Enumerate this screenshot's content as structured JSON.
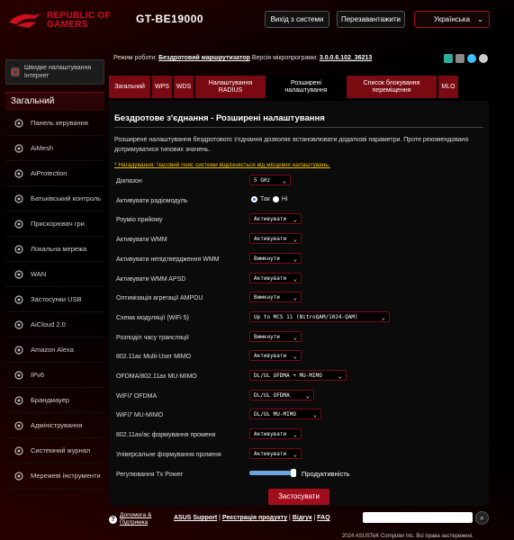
{
  "header": {
    "brand_line1": "REPUBLIC OF",
    "brand_line2": "GAMERS",
    "model": "GT-BE19000",
    "logout_label": "Вихід з системи",
    "reboot_label": "Перезавантажити",
    "language": "Українська"
  },
  "info": {
    "mode_label": "Режим роботи:",
    "mode_value": "Бездротовий маршрутизатор",
    "fw_label": "Версія мікропрограми:",
    "fw_value": "3.0.0.6.102_36213"
  },
  "sidebar": {
    "quick": "Швидке налаштування Інтернет",
    "section": "Загальний",
    "items": [
      {
        "label": "Панель керування",
        "icon": "dashboard-icon"
      },
      {
        "label": "AiMesh",
        "icon": "aimesh-icon"
      },
      {
        "label": "AiProtection",
        "icon": "shield-icon"
      },
      {
        "label": "Батьківський контроль",
        "icon": "parental-icon"
      },
      {
        "label": "Прискорювач гри",
        "icon": "gamepad-icon"
      },
      {
        "label": "Локальна мережа",
        "icon": "lan-icon"
      },
      {
        "label": "WAN",
        "icon": "globe-icon"
      },
      {
        "label": "Застосунки USB",
        "icon": "usb-icon"
      },
      {
        "label": "AiCloud 2.0",
        "icon": "cloud-icon"
      },
      {
        "label": "Amazon Alexa",
        "icon": "alexa-icon"
      },
      {
        "label": "IPv6",
        "icon": "ipv6-icon"
      },
      {
        "label": "Брандмауер",
        "icon": "firewall-icon"
      },
      {
        "label": "Адміністрування",
        "icon": "admin-icon"
      },
      {
        "label": "Системний журнал",
        "icon": "log-icon"
      },
      {
        "label": "Мережеві інструменти",
        "icon": "tools-icon"
      }
    ]
  },
  "tabs": [
    "Загальний",
    "WPS",
    "WDS",
    "Налаштування RADIUS",
    "Розширені налаштування",
    "Список блокування переміщення",
    "MLO"
  ],
  "panel": {
    "title": "Бездротове з'єднання - Розширені налаштування",
    "description": "Розширене налаштування бездротового з'єднання дозволяє встановлювати додаткові параметри. Проте рекомендовано дотримуватися типових значень.",
    "note": "* Нагадування: Часовий пояс системи відрізняється від місцевих налаштувань.",
    "rows": [
      {
        "label": "Діапазон",
        "value": "5 GHz"
      },
      {
        "label": "Активувати радіомодуль",
        "radio_yes": "Так",
        "radio_no": "Ні"
      },
      {
        "label": "Роуміо прийому",
        "value": "Активувати"
      },
      {
        "label": "Активувати WMM",
        "value": "Активувати"
      },
      {
        "label": "Активувати непідтвердження WMM",
        "value": "Вимкнути"
      },
      {
        "label": "Активувати WMM APSD",
        "value": "Активувати"
      },
      {
        "label": "Оптимізація агрегації AMPDU",
        "value": "Вимкнути"
      },
      {
        "label": "Схема модуляції (WiFi 5)",
        "value": "Up to MCS 11 (NitroQAM/1024-QAM)"
      },
      {
        "label": "Розподіл часу трансляції",
        "value": "Вимкнути"
      },
      {
        "label": "802.11ac Multi-User MIMO",
        "value": "Активувати"
      },
      {
        "label": "OFDMA/802.11ax MU-MIMO",
        "value": "DL/UL OFDMA + MU-MIMO"
      },
      {
        "label": "WiFi7 OFDMA",
        "value": "DL/UL OFDMA"
      },
      {
        "label": "WiFi7 MU-MIMO",
        "value": "DL/UL MU-MIMO"
      },
      {
        "label": "802.11ax/ac формування променя",
        "value": "Активувати"
      },
      {
        "label": "Універсальне формування променя",
        "value": "Активувати"
      },
      {
        "label": "Регулювання Tx Power",
        "value": "Продуктивність",
        "level": 1.0
      }
    ],
    "apply": "Застосувати"
  },
  "footer": {
    "help1": "Допомога &",
    "help2": "Підтримка",
    "link1": "ASUS Support",
    "link2": "Реєстрація продукту",
    "link3": "Відгук",
    "link4": "FAQ",
    "copyright": "2024 ASUSTeK Computer Inc. Всі права застережені."
  },
  "colors": {
    "accent": "#a10d1d",
    "tab": "#7a0a12",
    "note": "#f2c300"
  }
}
